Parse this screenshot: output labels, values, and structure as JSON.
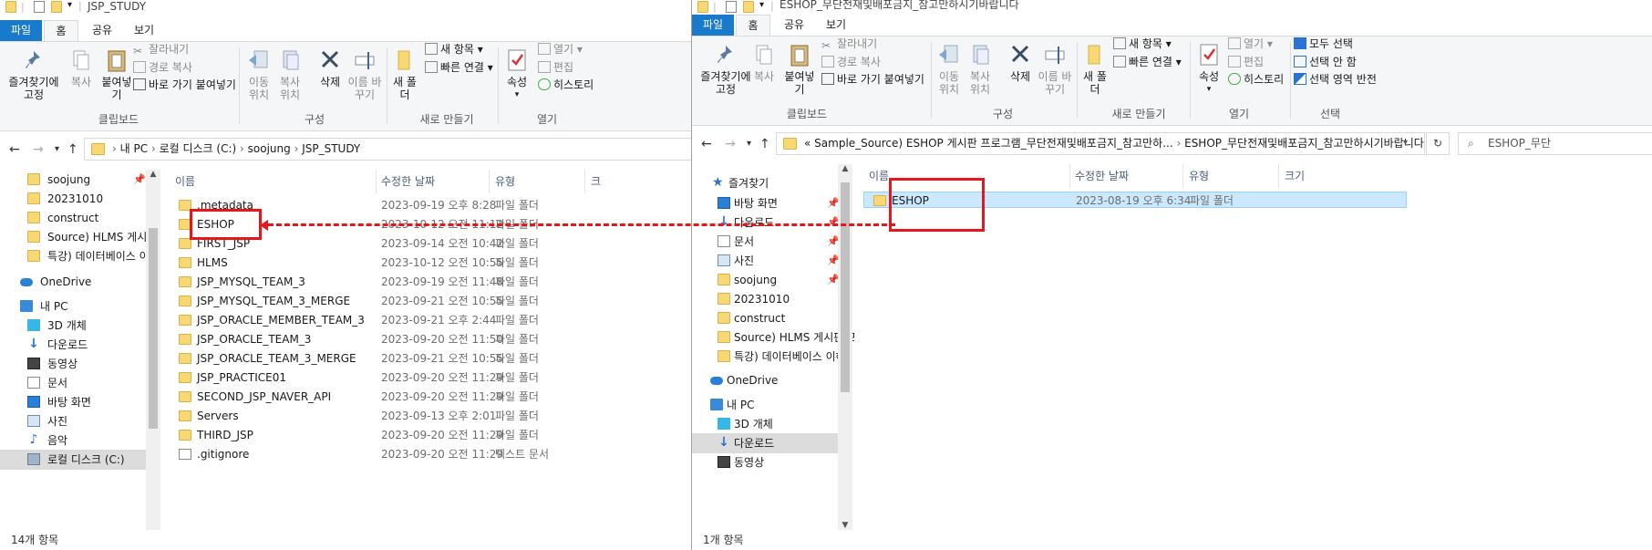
{
  "left_window": {
    "title": "JSP_STUDY",
    "tabs": [
      "파일",
      "홈",
      "공유",
      "보기"
    ],
    "ribbon": {
      "pin_label": "즐겨찾기에 고정",
      "copy_label": "복사",
      "paste_label": "붙여넣기",
      "cut_label": "잘라내기",
      "copy_path_label": "경로 복사",
      "paste_shortcut_label": "바로 가기 붙여넣기",
      "clipboard_group": "클립보드",
      "move_to_label": "이동 위치",
      "copy_to_label": "복사 위치",
      "delete_label": "삭제",
      "rename_label": "이름 바꾸기",
      "organize_group": "구성",
      "new_folder_label": "새 폴더",
      "new_item_label": "새 항목",
      "easy_access_label": "빠른 연결",
      "new_group": "새로 만들기",
      "properties_label": "속성",
      "open_label": "열기",
      "edit_label": "편집",
      "history_label": "히스토리",
      "open_group": "열기"
    },
    "breadcrumb": [
      "내 PC",
      "로컬 디스크 (C:)",
      "soojung",
      "JSP_STUDY"
    ],
    "nav_items": [
      {
        "label": "soojung",
        "icon": "folder-icon",
        "pinned": true
      },
      {
        "label": "20231010",
        "icon": "folder-icon",
        "pinned": false
      },
      {
        "label": "construct",
        "icon": "folder-icon",
        "pinned": false
      },
      {
        "label": "Source) HLMS 게시판 프",
        "icon": "folder-icon",
        "pinned": false
      },
      {
        "label": "특강) 데이터베이스 이해",
        "icon": "folder-icon",
        "pinned": false
      },
      {
        "label": "OneDrive",
        "icon": "cloud-icon",
        "pinned": false
      },
      {
        "label": "내 PC",
        "icon": "pc-icon",
        "pinned": false
      },
      {
        "label": "3D 개체",
        "icon": "cube-icon",
        "pinned": false
      },
      {
        "label": "다운로드",
        "icon": "download-icon",
        "pinned": false
      },
      {
        "label": "동영상",
        "icon": "video-icon",
        "pinned": false
      },
      {
        "label": "문서",
        "icon": "document-icon",
        "pinned": false
      },
      {
        "label": "바탕 화면",
        "icon": "desktop-icon",
        "pinned": false
      },
      {
        "label": "사진",
        "icon": "picture-icon",
        "pinned": false
      },
      {
        "label": "음악",
        "icon": "music-icon",
        "pinned": false
      },
      {
        "label": "로컬 디스크 (C:)",
        "icon": "drive-icon",
        "pinned": false
      }
    ],
    "columns": {
      "name": "이름",
      "date": "수정한 날짜",
      "type": "유형",
      "size": "크"
    },
    "files": [
      {
        "name": ".metadata",
        "date": "2023-09-19 오후 8:28",
        "type": "파일 폴더"
      },
      {
        "name": "ESHOP",
        "date": "2023-10-12 오전 11:12",
        "type": "파일 폴더"
      },
      {
        "name": "FIRST_JSP",
        "date": "2023-09-14 오전 10:42",
        "type": "파일 폴더"
      },
      {
        "name": "HLMS",
        "date": "2023-10-12 오전 10:55",
        "type": "파일 폴더"
      },
      {
        "name": "JSP_MYSQL_TEAM_3",
        "date": "2023-09-19 오전 11:48",
        "type": "파일 폴더"
      },
      {
        "name": "JSP_MYSQL_TEAM_3_MERGE",
        "date": "2023-09-21 오전 10:55",
        "type": "파일 폴더"
      },
      {
        "name": "JSP_ORACLE_MEMBER_TEAM_3",
        "date": "2023-09-21 오후 2:44",
        "type": "파일 폴더"
      },
      {
        "name": "JSP_ORACLE_TEAM_3",
        "date": "2023-09-20 오전 11:50",
        "type": "파일 폴더"
      },
      {
        "name": "JSP_ORACLE_TEAM_3_MERGE",
        "date": "2023-09-21 오전 10:55",
        "type": "파일 폴더"
      },
      {
        "name": "JSP_PRACTICE01",
        "date": "2023-09-20 오전 11:29",
        "type": "파일 폴더"
      },
      {
        "name": "SECOND_JSP_NAVER_API",
        "date": "2023-09-20 오전 11:29",
        "type": "파일 폴더"
      },
      {
        "name": "Servers",
        "date": "2023-09-13 오후 2:01",
        "type": "파일 폴더"
      },
      {
        "name": "THIRD_JSP",
        "date": "2023-09-20 오전 11:29",
        "type": "파일 폴더"
      },
      {
        "name": ".gitignore",
        "date": "2023-09-20 오전 11:29",
        "type": "텍스트 문서"
      }
    ],
    "status": "14개 항목"
  },
  "right_window": {
    "title": "ESHOP_무단전재및배포금지_참고만하시기바랍니다",
    "tabs": [
      "파일",
      "홈",
      "공유",
      "보기"
    ],
    "ribbon": {
      "pin_label": "즐겨찾기에 고정",
      "copy_label": "복사",
      "paste_label": "붙여넣기",
      "cut_label": "잘라내기",
      "copy_path_label": "경로 복사",
      "paste_shortcut_label": "바로 가기 붙여넣기",
      "clipboard_group": "클립보드",
      "move_to_label": "이동 위치",
      "copy_to_label": "복사 위치",
      "delete_label": "삭제",
      "rename_label": "이름 바꾸기",
      "organize_group": "구성",
      "new_folder_label": "새 폴더",
      "new_item_label": "새 항목",
      "easy_access_label": "빠른 연결",
      "new_group": "새로 만들기",
      "properties_label": "속성",
      "open_label": "열기",
      "edit_label": "편집",
      "history_label": "히스토리",
      "open_group": "열기",
      "select_all_label": "모두 선택",
      "select_none_label": "선택 안 함",
      "invert_selection_label": "선택 영역 반전",
      "select_group": "선택"
    },
    "breadcrumb": [
      "Sample_Source) ESHOP 게시판 프로그램_무단전재및배포금지_참고만하...",
      "ESHOP_무단전재및배포금지_참고만하시기바랍니다"
    ],
    "breadcrumb_overflow": "«",
    "search_placeholder": "ESHOP_무단",
    "nav_items": [
      {
        "label": "즐겨찾기",
        "icon": "star-icon",
        "pinned": false
      },
      {
        "label": "바탕 화면",
        "icon": "desktop-icon",
        "pinned": true
      },
      {
        "label": "다운로드",
        "icon": "download-icon",
        "pinned": true
      },
      {
        "label": "문서",
        "icon": "document-icon",
        "pinned": true
      },
      {
        "label": "사진",
        "icon": "picture-icon",
        "pinned": true
      },
      {
        "label": "soojung",
        "icon": "folder-icon",
        "pinned": true
      },
      {
        "label": "20231010",
        "icon": "folder-icon",
        "pinned": false
      },
      {
        "label": "construct",
        "icon": "folder-icon",
        "pinned": false
      },
      {
        "label": "Source) HLMS 게시판 프",
        "icon": "folder-icon",
        "pinned": false
      },
      {
        "label": "특강) 데이터베이스 이해",
        "icon": "folder-icon",
        "pinned": false
      },
      {
        "label": "OneDrive",
        "icon": "cloud-icon",
        "pinned": false
      },
      {
        "label": "내 PC",
        "icon": "pc-icon",
        "pinned": false
      },
      {
        "label": "3D 개체",
        "icon": "cube-icon",
        "pinned": false
      },
      {
        "label": "다운로드",
        "icon": "download-icon",
        "pinned": false
      },
      {
        "label": "동영상",
        "icon": "video-icon",
        "pinned": false
      }
    ],
    "columns": {
      "name": "이름",
      "date": "수정한 날짜",
      "type": "유형",
      "size": "크기"
    },
    "files": [
      {
        "name": "ESHOP",
        "date": "2023-08-19 오후 6:34",
        "type": "파일 폴더"
      }
    ],
    "status": "1개 항목"
  },
  "accent_colors": {
    "file_tab": "#1979ca",
    "highlight": "#e8161b",
    "folder": "#f8d775",
    "selection": "#cce8ff"
  }
}
